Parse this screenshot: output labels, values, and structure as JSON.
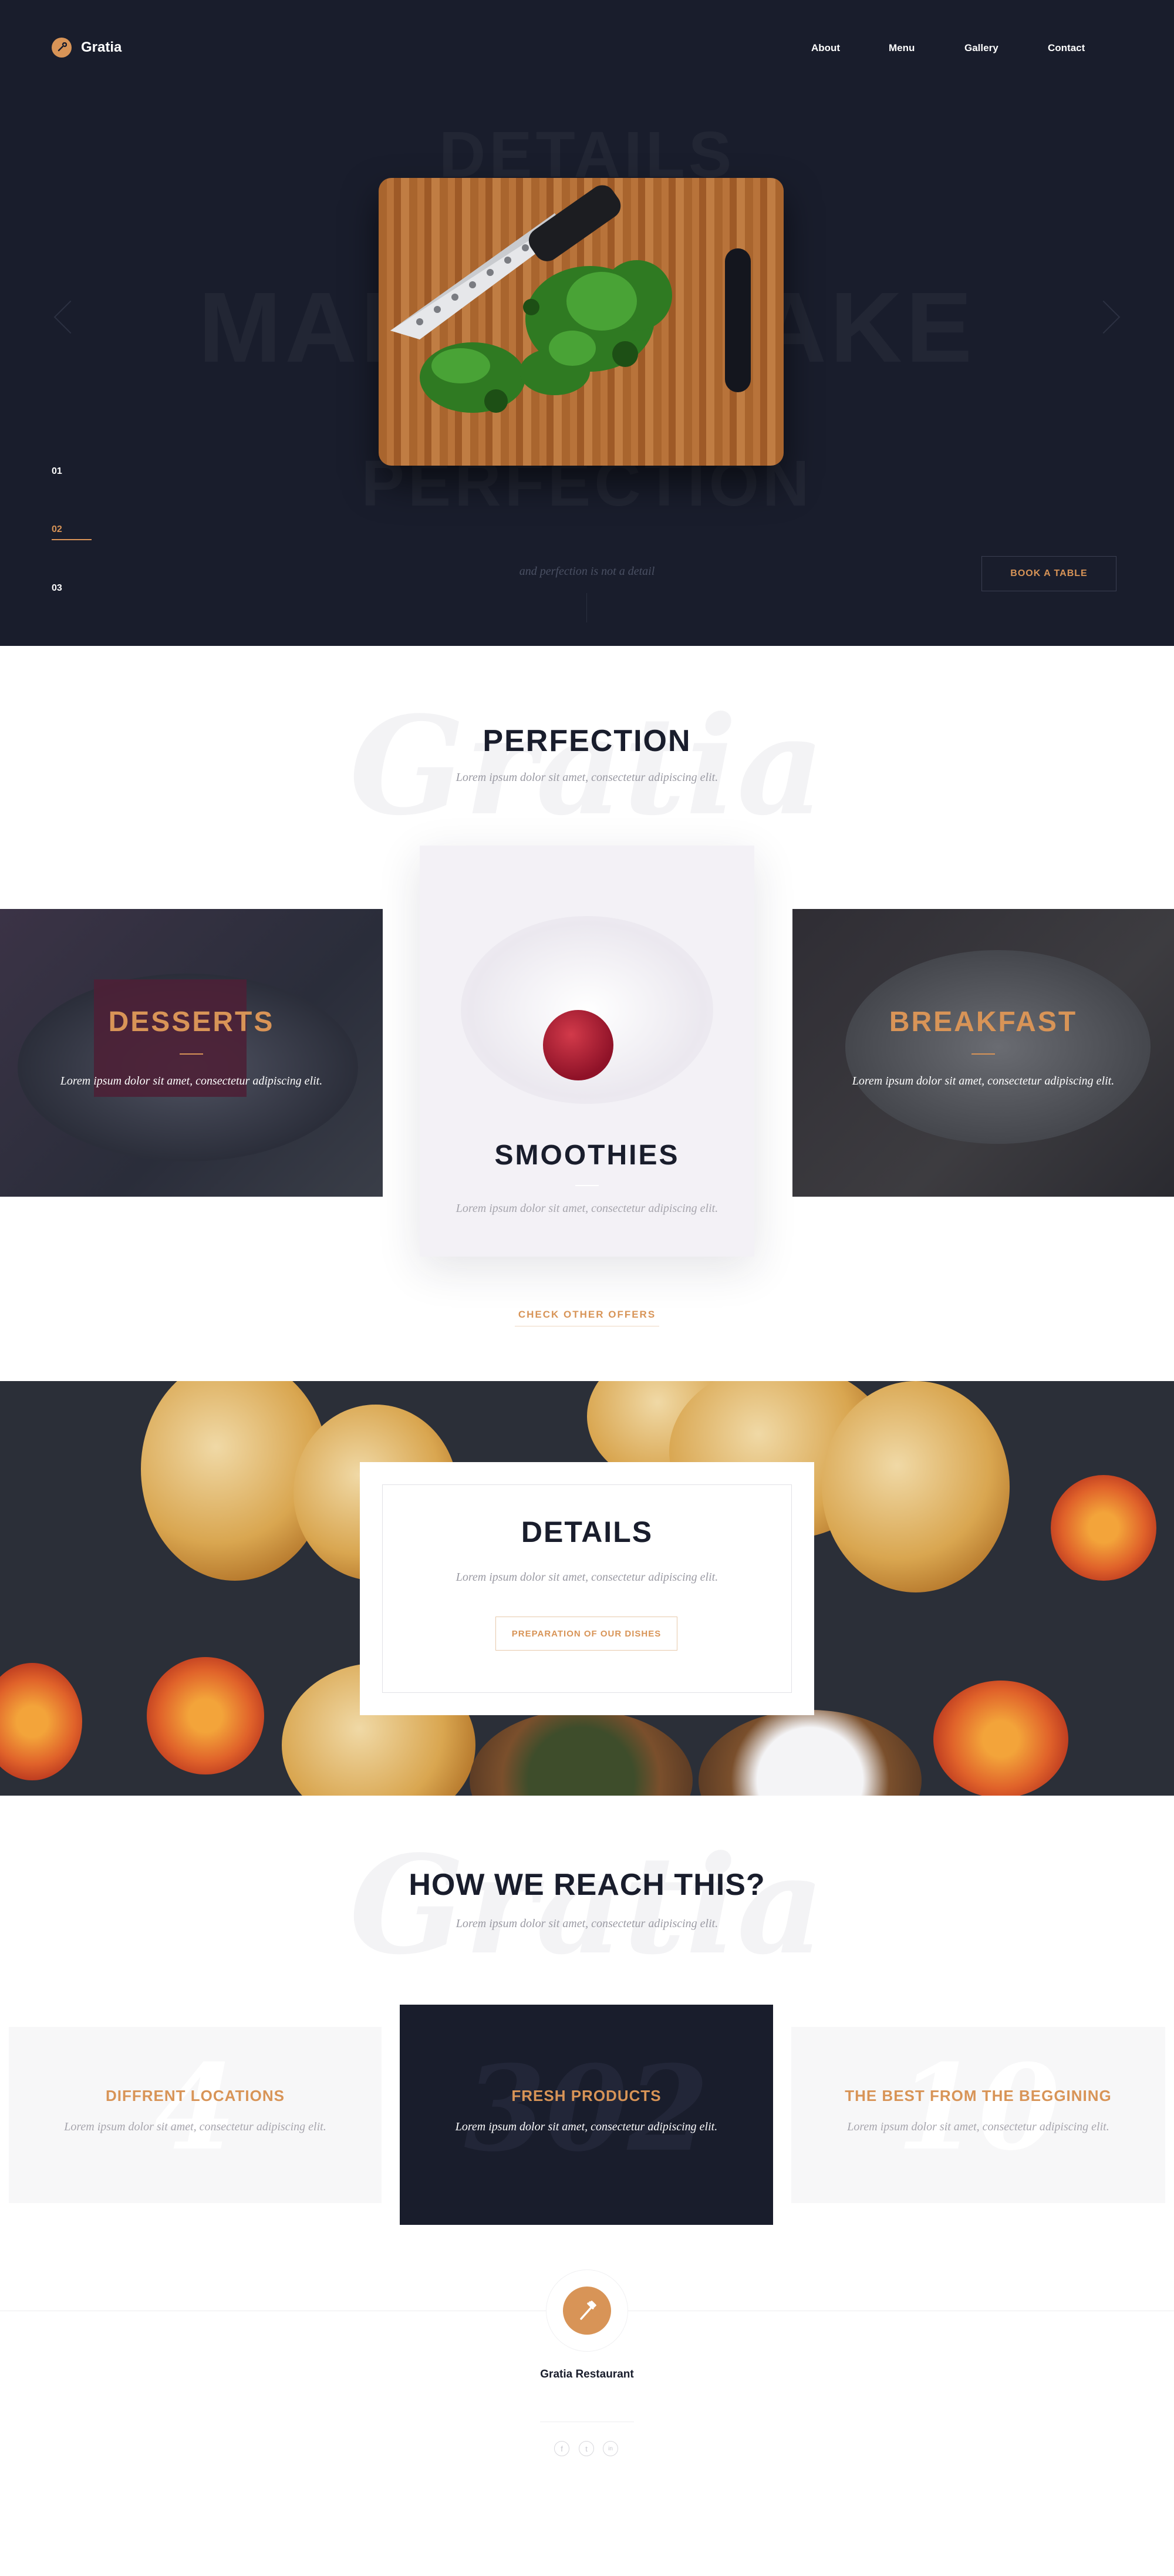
{
  "brand": {
    "name": "Gratia"
  },
  "nav": {
    "items": [
      "About",
      "Menu",
      "Gallery",
      "Contact"
    ]
  },
  "hero": {
    "ghost_lines": [
      "DETAILS",
      "MAKE",
      "MAKE",
      "PERFECTION"
    ],
    "slides": [
      "01",
      "02",
      "03"
    ],
    "active_slide": "02",
    "subtitle": "and perfection is not a detail",
    "book_button": "BOOK A TABLE"
  },
  "perfection": {
    "title": "PERFECTION",
    "script_bg": "Gratia",
    "subtitle": "Lorem ipsum dolor sit amet, consectetur adipiscing elit.",
    "offers": [
      {
        "title": "DESSERTS",
        "desc": "Lorem ipsum dolor sit amet, consectetur adipiscing elit."
      },
      {
        "title": "SMOOTHIES",
        "desc": "Lorem ipsum dolor sit amet, consectetur adipiscing elit."
      },
      {
        "title": "BREAKFAST",
        "desc": "Lorem ipsum dolor sit amet, consectetur adipiscing elit."
      }
    ],
    "more_link": "CHECK OTHER OFFERS"
  },
  "details": {
    "title": "DETAILS",
    "subtitle": "Lorem ipsum dolor sit amet, consectetur adipiscing elit.",
    "button": "PREPARATION OF OUR DISHES"
  },
  "reach": {
    "title": "HOW WE REACH THIS?",
    "script_bg": "Gratia",
    "subtitle": "Lorem ipsum dolor sit amet, consectetur adipiscing elit.",
    "cards": [
      {
        "number": "4",
        "title": "DIFFRENT LOCATIONS",
        "desc": "Lorem ipsum dolor sit amet, consectetur adipiscing elit."
      },
      {
        "number": "302",
        "title": "FRESH PRODUCTS",
        "desc": "Lorem ipsum dolor sit amet, consectetur adipiscing elit."
      },
      {
        "number": "10",
        "title": "THE BEST FROM THE BEGGINING",
        "desc": "Lorem ipsum dolor sit amet, consectetur adipiscing elit."
      }
    ]
  },
  "footer": {
    "name": "Gratia Restaurant",
    "social": [
      "f",
      "t",
      "in"
    ]
  },
  "colors": {
    "accent": "#d89457",
    "dark": "#191d2c"
  }
}
